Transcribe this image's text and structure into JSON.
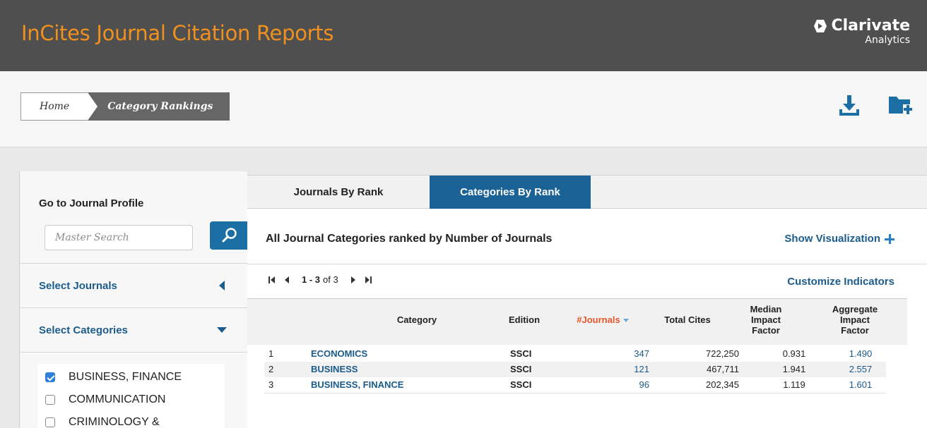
{
  "app": {
    "title": "InCites Journal Citation Reports",
    "brand_name": "Clarivate",
    "brand_sub": "Analytics"
  },
  "breadcrumb": {
    "home": "Home",
    "current": "Category Rankings"
  },
  "toolbar": {
    "icons": [
      "download-icon",
      "add-folder-icon"
    ]
  },
  "sidebar": {
    "go_title": "Go to Journal Profile",
    "search_placeholder": "Master Search",
    "select_journals": "Select Journals",
    "select_categories": "Select Categories",
    "categories": [
      {
        "label": "BUSINESS, FINANCE",
        "checked": true
      },
      {
        "label": "COMMUNICATION",
        "checked": false
      },
      {
        "label": "CRIMINOLOGY &",
        "checked": false
      }
    ]
  },
  "tabs": {
    "journals": "Journals By Rank",
    "categories": "Categories By Rank",
    "active": "categories"
  },
  "main": {
    "heading": "All Journal Categories ranked by Number of Journals",
    "show_visualization": "Show Visualization",
    "customize": "Customize Indicators",
    "pager": {
      "range": "1 - 3",
      "of_text": "of 3"
    }
  },
  "table": {
    "headers": {
      "category": "Category",
      "edition": "Edition",
      "journals": "#Journals",
      "total_cites": "Total Cites",
      "median_if": "Median Impact Factor",
      "aggregate_if": "Aggregate Impact Factor"
    },
    "rows": [
      {
        "rank": "1",
        "category": "ECONOMICS",
        "edition": "SSCI",
        "journals": "347",
        "total_cites": "722,250",
        "median_if": "0.931",
        "aggregate_if": "1.490"
      },
      {
        "rank": "2",
        "category": "BUSINESS",
        "edition": "SSCI",
        "journals": "121",
        "total_cites": "467,711",
        "median_if": "1.941",
        "aggregate_if": "2.557"
      },
      {
        "rank": "3",
        "category": "BUSINESS, FINANCE",
        "edition": "SSCI",
        "journals": "96",
        "total_cites": "202,345",
        "median_if": "1.119",
        "aggregate_if": "1.601"
      }
    ]
  },
  "colors": {
    "title_orange": "#f0911f",
    "header_dark": "#4f4f4f",
    "accent_blue": "#1b6296",
    "link_blue": "#1c5c8c",
    "sort_red": "#e8552b"
  }
}
